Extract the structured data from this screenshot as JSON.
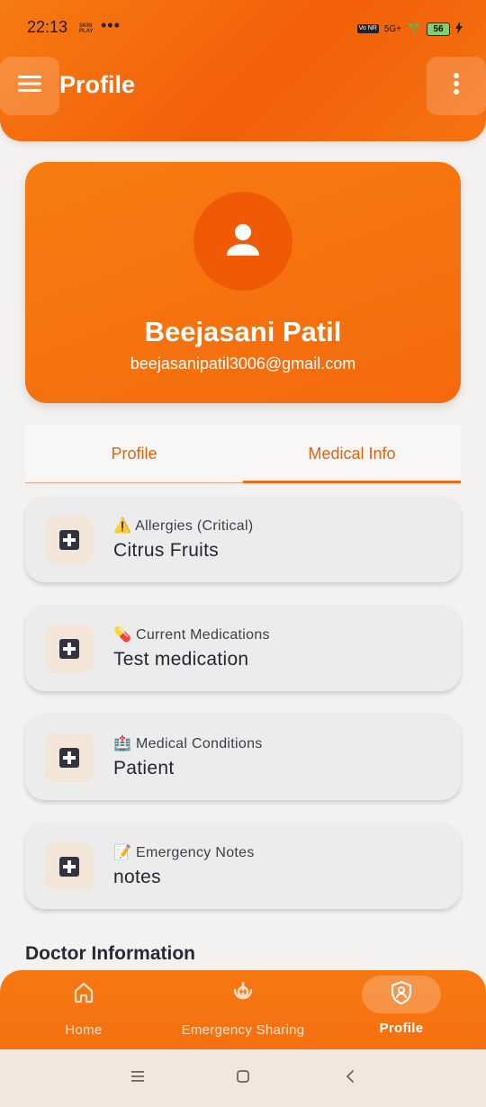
{
  "status_bar": {
    "time": "22:13",
    "mini_text": "SKIN PLAY",
    "dots": "•••",
    "volte": "Vo NR",
    "network": "5G+",
    "battery": "56"
  },
  "header": {
    "title": "Profile",
    "menu_icon": "hamburger-icon",
    "more_icon": "more-vertical-icon"
  },
  "profile": {
    "name": "Beejasani Patil",
    "email": "beejasanipatil3006@gmail.com",
    "avatar_icon": "person-icon"
  },
  "tabs": [
    {
      "label": "Profile",
      "active": false
    },
    {
      "label": "Medical Info",
      "active": true
    }
  ],
  "medical_info": [
    {
      "emoji": "⚠️",
      "label": "Allergies (Critical)",
      "value": "Citrus Fruits"
    },
    {
      "emoji": "💊",
      "label": "Current Medications",
      "value": "Test medication"
    },
    {
      "emoji": "🏥",
      "label": "Medical Conditions",
      "value": "Patient"
    },
    {
      "emoji": "📝",
      "label": "Emergency Notes",
      "value": "notes"
    }
  ],
  "sections": {
    "doctor_title": "Doctor Information"
  },
  "bottom_nav": [
    {
      "label": "Home",
      "icon": "home-icon",
      "active": false
    },
    {
      "label": "Emergency Sharing",
      "icon": "emergency-broadcast-icon",
      "active": false
    },
    {
      "label": "Profile",
      "icon": "shield-user-icon",
      "active": true
    }
  ],
  "colors": {
    "primary": "#f46a0c",
    "background": "#f4f1f1",
    "card": "#ececec"
  }
}
